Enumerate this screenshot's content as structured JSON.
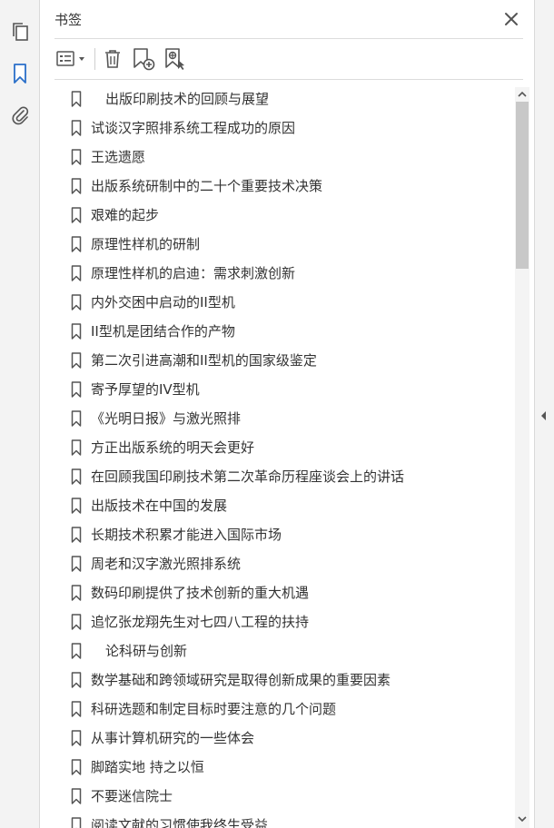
{
  "panel": {
    "title": "书签"
  },
  "icons": {
    "rail": [
      "pages-icon",
      "bookmark-icon",
      "attachment-icon"
    ],
    "toolbar": [
      "options-menu-icon",
      "delete-icon",
      "new-bookmark-icon",
      "new-bookmark-from-structure-icon"
    ],
    "close": "close-icon"
  },
  "colors": {
    "accent": "#2a6fc9",
    "icon": "#555555"
  },
  "bookmarks": [
    {
      "label": "出版印刷技术的回顾与展望",
      "indent": true
    },
    {
      "label": "试谈汉字照排系统工程成功的原因",
      "indent": false
    },
    {
      "label": "王选遗愿",
      "indent": false
    },
    {
      "label": "出版系统研制中的二十个重要技术决策",
      "indent": false
    },
    {
      "label": "艰难的起步",
      "indent": false
    },
    {
      "label": "原理性样机的研制",
      "indent": false
    },
    {
      "label": "原理性样机的启迪：需求刺激创新",
      "indent": false
    },
    {
      "label": "内外交困中启动的II型机",
      "indent": false
    },
    {
      "label": "II型机是团结合作的产物",
      "indent": false
    },
    {
      "label": "第二次引进高潮和II型机的国家级鉴定",
      "indent": false
    },
    {
      "label": "寄予厚望的IV型机",
      "indent": false
    },
    {
      "label": "《光明日报》与激光照排",
      "indent": false
    },
    {
      "label": "方正出版系统的明天会更好",
      "indent": false
    },
    {
      "label": "在回顾我国印刷技术第二次革命历程座谈会上的讲话",
      "indent": false
    },
    {
      "label": "出版技术在中国的发展",
      "indent": false
    },
    {
      "label": "长期技术积累才能进入国际市场",
      "indent": false
    },
    {
      "label": "周老和汉字激光照排系统",
      "indent": false
    },
    {
      "label": "数码印刷提供了技术创新的重大机遇",
      "indent": false
    },
    {
      "label": "追忆张龙翔先生对七四八工程的扶持",
      "indent": false
    },
    {
      "label": "论科研与创新",
      "indent": true
    },
    {
      "label": "数学基础和跨领域研究是取得创新成果的重要因素",
      "indent": false
    },
    {
      "label": "科研选题和制定目标时要注意的几个问题",
      "indent": false
    },
    {
      "label": "从事计算机研究的一些体会",
      "indent": false
    },
    {
      "label": "脚踏实地 持之以恒",
      "indent": false
    },
    {
      "label": "不要迷信院士",
      "indent": false
    },
    {
      "label": "阅读文献的习惯使我终生受益",
      "indent": false
    }
  ]
}
